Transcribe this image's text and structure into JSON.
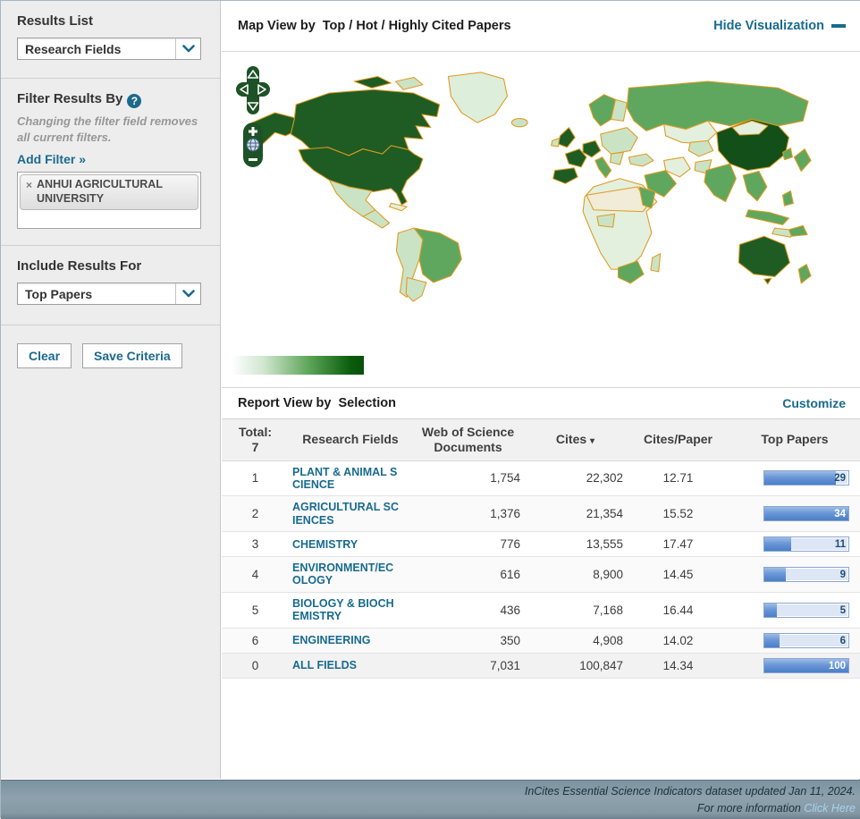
{
  "sidebar": {
    "results_list": {
      "label": "Results List",
      "dropdown_value": "Research Fields"
    },
    "filter": {
      "label": "Filter Results By",
      "help_icon": "?",
      "note": "Changing the filter field removes all current filters.",
      "add_filter_label": "Add Filter »",
      "chip": {
        "remove_icon": "×",
        "label": "ANHUI AGRICULTURAL UNIVERSITY"
      }
    },
    "include_results": {
      "label": "Include Results For",
      "dropdown_value": "Top Papers"
    },
    "buttons": {
      "clear": "Clear",
      "save": "Save Criteria"
    }
  },
  "map_panel": {
    "title_prefix": "Map View by",
    "title": "Top / Hot / Highly Cited Papers",
    "hide_link": "Hide Visualization",
    "controls": {
      "zoom_in": "+",
      "zoom_out": "−",
      "globe_icon": "globe"
    },
    "legend": {
      "min_color": "#ffffff",
      "max_color": "#07500a"
    }
  },
  "report_panel": {
    "title_prefix": "Report View by",
    "title": "Selection",
    "customize_link": "Customize"
  },
  "table": {
    "total_label": "Total:",
    "total_value": "7",
    "columns": {
      "field": "Research Fields",
      "docs_line1": "Web of Science",
      "docs_line2": "Documents",
      "cites": "Cites",
      "sort_arrow": "▾",
      "cites_per_paper": "Cites/Paper",
      "top_papers": "Top Papers"
    },
    "rows": [
      {
        "rank": "1",
        "field": "PLANT & ANIMAL SCIENCE",
        "documents": "1,754",
        "cites": "22,302",
        "cites_per_paper": "12.71",
        "top_papers": "29",
        "bar_pct": 85
      },
      {
        "rank": "2",
        "field": "AGRICULTURAL SCIENCES",
        "documents": "1,376",
        "cites": "21,354",
        "cites_per_paper": "15.52",
        "top_papers": "34",
        "bar_pct": 100
      },
      {
        "rank": "3",
        "field": "CHEMISTRY",
        "documents": "776",
        "cites": "13,555",
        "cites_per_paper": "17.47",
        "top_papers": "11",
        "bar_pct": 32
      },
      {
        "rank": "4",
        "field": "ENVIRONMENT/ECOLOGY",
        "documents": "616",
        "cites": "8,900",
        "cites_per_paper": "14.45",
        "top_papers": "9",
        "bar_pct": 26
      },
      {
        "rank": "5",
        "field": "BIOLOGY & BIOCHEMISTRY",
        "documents": "436",
        "cites": "7,168",
        "cites_per_paper": "16.44",
        "top_papers": "5",
        "bar_pct": 15
      },
      {
        "rank": "6",
        "field": "ENGINEERING",
        "documents": "350",
        "cites": "4,908",
        "cites_per_paper": "14.02",
        "top_papers": "6",
        "bar_pct": 18
      },
      {
        "rank": "0",
        "field": "ALL FIELDS",
        "documents": "7,031",
        "cites": "100,847",
        "cites_per_paper": "14.34",
        "top_papers": "100",
        "bar_pct": 100
      }
    ]
  },
  "footer": {
    "line1": "InCites Essential Science Indicators dataset updated Jan 11, 2024.",
    "line2": "For more information",
    "link_label": "Click Here"
  },
  "colors": {
    "accent_teal": "#186b8e",
    "sort_blue": "#4d7ebf",
    "bar_blue": "#4a7fc8",
    "map_border": "#e09a1e",
    "map_dark_green": "#1e5c24",
    "map_darkest_green": "#134f18",
    "map_medium_green": "#5fa75e",
    "map_light_green": "#cbe3c5",
    "footer_bg": "#8499a5"
  }
}
